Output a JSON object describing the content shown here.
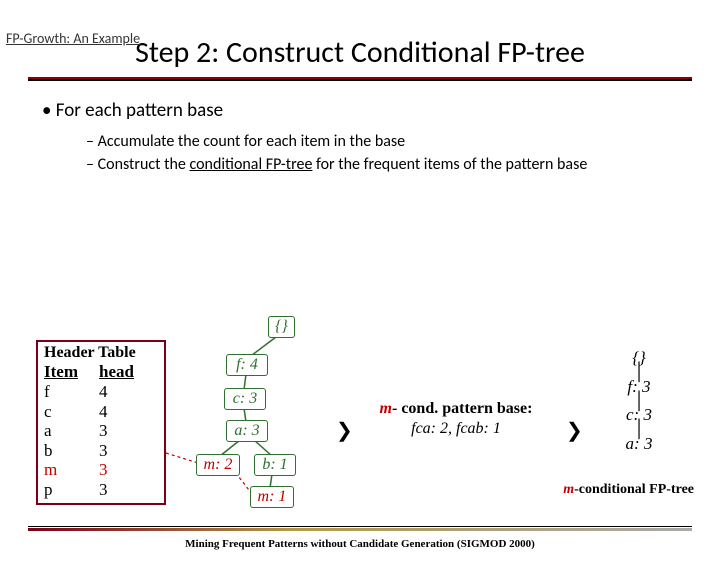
{
  "corner": "FP-Growth: An Example",
  "title": "Step 2: Construct Conditional FP-tree",
  "b1": "For each pattern base",
  "b2a": "Accumulate the count for each item in the base",
  "b2b_pre": "Construct the ",
  "b2b_u": "conditional FP-tree",
  "b2b_post": " for the frequent items of the pattern base",
  "ht": {
    "title": "Header Table",
    "col1": "Item",
    "col2": "head",
    "rows": [
      {
        "item": "f",
        "head": "4"
      },
      {
        "item": "c",
        "head": "4"
      },
      {
        "item": "a",
        "head": "3"
      },
      {
        "item": "b",
        "head": "3"
      },
      {
        "item": "m",
        "head": "3"
      },
      {
        "item": "p",
        "head": "3"
      }
    ]
  },
  "tree": {
    "root": "{}",
    "f4": "f: 4",
    "c3": "c: 3",
    "a3": "a: 3",
    "m2": "m: 2",
    "b1": "b: 1",
    "m1": "m: 1"
  },
  "pb": {
    "m": "m",
    "label": "- cond. pattern base:",
    "val": "fca: 2, fcab: 1"
  },
  "ct": {
    "root": "{}",
    "f3": "f: 3",
    "c3": "c: 3",
    "a3": "a: 3"
  },
  "ct_label_m": "m",
  "ct_label_rest": "-conditional FP-tree",
  "footer": "Mining Frequent Patterns without Candidate Generation (SIGMOD 2000)"
}
